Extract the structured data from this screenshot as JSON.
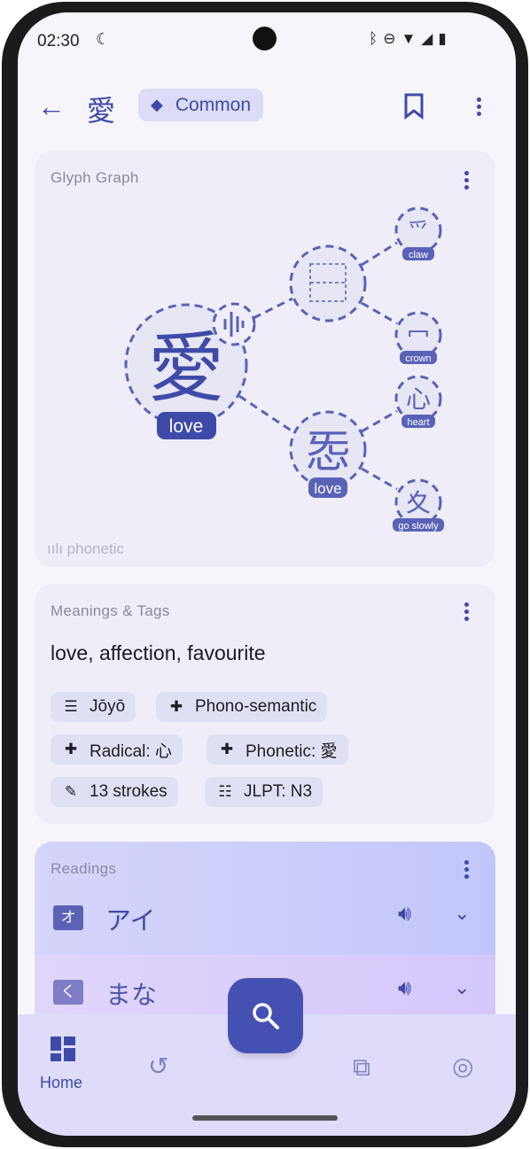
{
  "status_bar": {
    "time": "02:30"
  },
  "app_bar": {
    "kanji": "愛",
    "badge": "Common"
  },
  "glyph_graph": {
    "title": "Glyph Graph",
    "legend": "phonetic",
    "root": {
      "char": "愛",
      "label": "love"
    },
    "nodes": [
      {
        "char": "",
        "label": ""
      },
      {
        "char": "㤅",
        "label": "love"
      },
      {
        "char": "爫",
        "label": "claw"
      },
      {
        "char": "冖",
        "label": "crown"
      },
      {
        "char": "心",
        "label": "heart"
      },
      {
        "char": "夊",
        "label": "go slowly"
      }
    ]
  },
  "meanings": {
    "title": "Meanings & Tags",
    "text": "love, affection, favourite",
    "tags": [
      "Jōyō",
      "Phono-semantic",
      "Radical: 心",
      "Phonetic: 愛",
      "13 strokes",
      "JLPT: N3"
    ]
  },
  "readings": {
    "title": "Readings",
    "items": [
      {
        "type": "on",
        "badge": "オ",
        "text": "アイ"
      },
      {
        "type": "kun",
        "badge": "く",
        "text": "まな"
      }
    ]
  },
  "bottom_nav": {
    "items": [
      {
        "label": "Home",
        "icon": "grid-icon"
      },
      {
        "icon": "history-icon"
      },
      {
        "icon": "bookmarks-icon"
      },
      {
        "icon": "account-sync-icon"
      }
    ]
  },
  "colors": {
    "accent": "#3f4aa8",
    "card": "#efeef8",
    "node": "#5a62b8"
  }
}
